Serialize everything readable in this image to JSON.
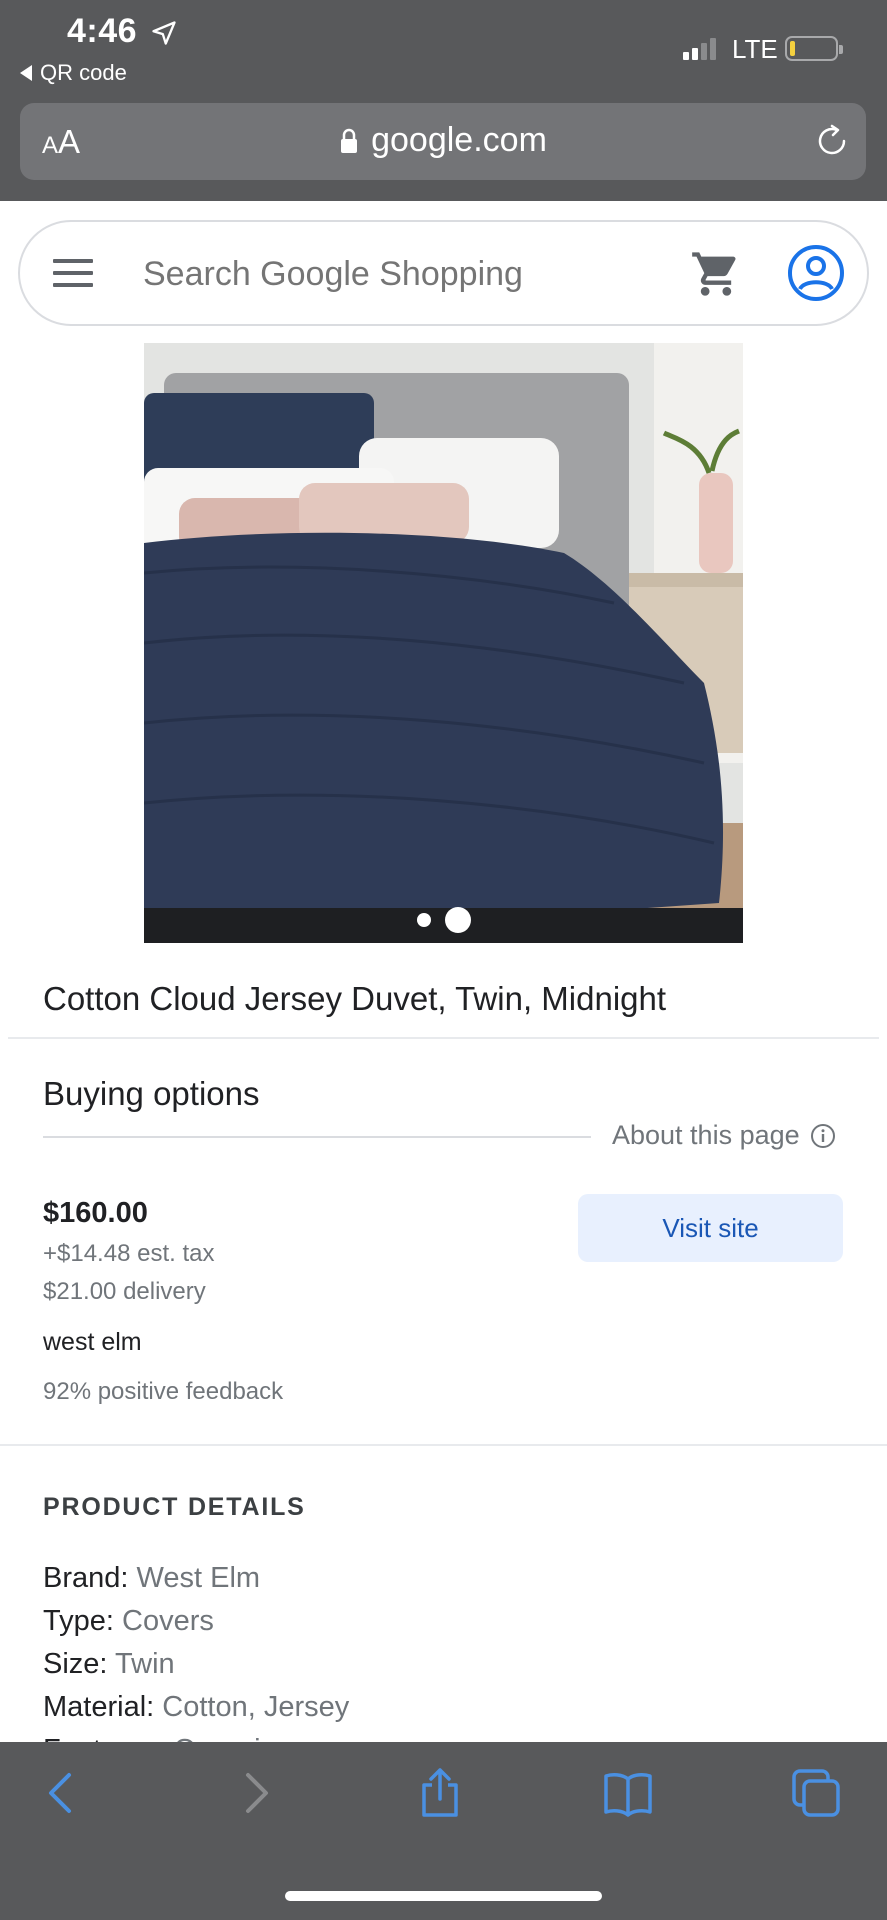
{
  "status_bar": {
    "time": "4:46",
    "back_app": "QR code",
    "network": "LTE"
  },
  "browser": {
    "text_size_small": "A",
    "text_size_big": "A",
    "url": "google.com"
  },
  "search": {
    "placeholder": "Search Google Shopping"
  },
  "product": {
    "title": "Cotton Cloud Jersey Duvet, Twin, Midnight",
    "image_count": 2,
    "active_image_index": 2
  },
  "buying_options": {
    "heading": "Buying options",
    "about_link": "About this page",
    "price": "$160.00",
    "tax": "+$14.48 est. tax",
    "delivery": "$21.00 delivery",
    "merchant": "west elm",
    "feedback": "92% positive feedback",
    "visit_label": "Visit site"
  },
  "product_details": {
    "heading": "PRODUCT DETAILS",
    "rows": [
      {
        "key": "Brand:",
        "value": "West Elm"
      },
      {
        "key": "Type:",
        "value": "Covers"
      },
      {
        "key": "Size:",
        "value": "Twin"
      },
      {
        "key": "Material:",
        "value": "Cotton, Jersey"
      },
      {
        "key": "Features:",
        "value": "Organic"
      }
    ]
  },
  "colors": {
    "chrome": "#58595b",
    "accent_blue": "#1a73e8",
    "visit_bg": "#e8f0fe",
    "toolbar_icon": "#4a90e2"
  },
  "icons": {
    "menu": "menu-icon",
    "cart": "cart-icon",
    "account": "account-icon",
    "lock": "lock-icon",
    "reload": "reload-icon",
    "info": "info-icon",
    "back": "back-icon",
    "forward": "forward-icon",
    "share": "share-icon",
    "bookmarks": "bookmarks-icon",
    "tabs": "tabs-icon"
  }
}
